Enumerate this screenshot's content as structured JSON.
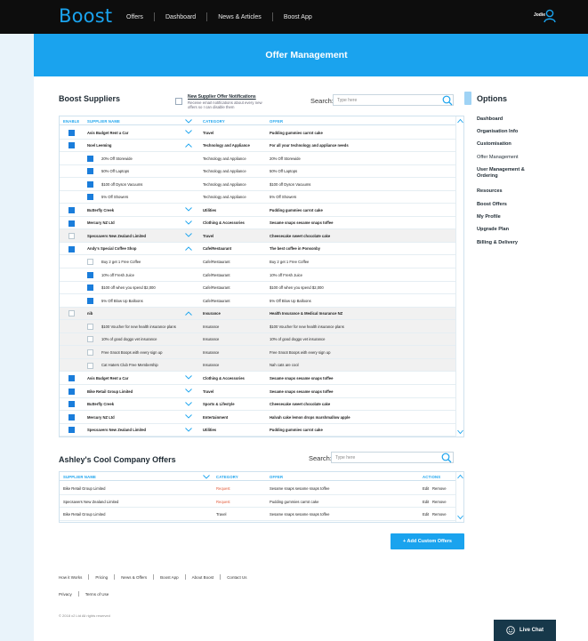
{
  "nav": {
    "brand": "Boost",
    "links": [
      "Offers",
      "Dashboard",
      "News & Articles",
      "Boost App"
    ],
    "user": "Jodie"
  },
  "banner": {
    "title": "Offer Management"
  },
  "suppliers": {
    "title": "Boost Suppliers",
    "notification_title": "New Supplier Offer Notifications",
    "notification_desc": "Receive email notifications about every new offers so I can disable them",
    "search_label": "Search:",
    "search_placeholder": "Type here",
    "columns": [
      "ENABLE",
      "SUPPLIER NAME",
      "CATEGORY",
      "OFFER"
    ],
    "rows": [
      {
        "level": 0,
        "checked": true,
        "name": "Avis Budget Rent a Car",
        "chev": "down",
        "category": "Travel",
        "offer": "Pudding gummies carrot cake",
        "alt": false
      },
      {
        "level": 0,
        "checked": true,
        "name": "Noel Leeming",
        "chev": "up",
        "category": "Technology and Appliance",
        "offer": "For all your technology and appliance needs",
        "alt": false
      },
      {
        "level": 1,
        "checked": true,
        "name": "20% Off Storewide",
        "chev": "",
        "category": "Technology and Appliance",
        "offer": "20% Off Storewide",
        "alt": false
      },
      {
        "level": 1,
        "checked": true,
        "name": "50% Off Laptops",
        "chev": "",
        "category": "Technology and Appliance",
        "offer": "50% Off Laptops",
        "alt": false
      },
      {
        "level": 1,
        "checked": true,
        "name": "$100 off Dyson Vacuums",
        "chev": "",
        "category": "Technology and Appliance",
        "offer": "$100 off Dyson Vacuums",
        "alt": false
      },
      {
        "level": 1,
        "checked": true,
        "name": "5% Off Showers",
        "chev": "",
        "category": "Technology and Appliance",
        "offer": "5% Off Showers",
        "alt": false
      },
      {
        "level": 0,
        "checked": true,
        "name": "Butterfly Creek",
        "chev": "down",
        "category": "Utilities",
        "offer": "Pudding gummies carrot cake",
        "alt": false
      },
      {
        "level": 0,
        "checked": true,
        "name": "Mercury NZ Ltd",
        "chev": "down",
        "category": "Clothing & Accessories",
        "offer": "Sesame snaps sesame snaps toffee",
        "alt": false
      },
      {
        "level": 0,
        "checked": false,
        "name": "Specsavers New Zealand Limited",
        "chev": "down",
        "category": "Travel",
        "offer": "Cheesecake sweet chocolate cake",
        "alt": true
      },
      {
        "level": 0,
        "checked": true,
        "name": "Andy's Special Coffee Shop",
        "chev": "up",
        "category": "Cafe/Restaurant",
        "offer": "The best coffee in Ponsonby",
        "alt": false
      },
      {
        "level": 1,
        "checked": false,
        "name": "Buy 2 get 1 Free Coffee",
        "chev": "",
        "category": "Cafe/Restaurant",
        "offer": "Buy 2 get 1 Free Coffee",
        "alt": false
      },
      {
        "level": 1,
        "checked": true,
        "name": "10% off Fresh Juice",
        "chev": "",
        "category": "Cafe/Restaurant",
        "offer": "10% off Fresh Juice",
        "alt": false
      },
      {
        "level": 1,
        "checked": true,
        "name": "$100 off when you spend $2,000",
        "chev": "",
        "category": "Cafe/Restaurant",
        "offer": "$100 off when you spend $2,000",
        "alt": false
      },
      {
        "level": 1,
        "checked": true,
        "name": "5% Off Blow Up Balloons",
        "chev": "",
        "category": "Cafe/Restaurant",
        "offer": "5% Off Blow Up Balloons",
        "alt": false
      },
      {
        "level": 0,
        "checked": false,
        "name": "nib",
        "chev": "up",
        "category": "Insurance",
        "offer": "Health Insurance & Medical Insurance NZ",
        "alt": true
      },
      {
        "level": 1,
        "checked": false,
        "name": "$100 Voucher for new health insurance plans",
        "chev": "",
        "category": "Insurance",
        "offer": "$100 Voucher for new health insurance plans",
        "alt": true
      },
      {
        "level": 1,
        "checked": false,
        "name": "10% of good doggo vet insurance",
        "chev": "",
        "category": "Insurance",
        "offer": "10% of good doggo vet insurance",
        "alt": true
      },
      {
        "level": 1,
        "checked": false,
        "name": "Free Snoot Boops with every sign up",
        "chev": "",
        "category": "Insurance",
        "offer": "Free Snoot Boops with every sign up",
        "alt": true
      },
      {
        "level": 1,
        "checked": false,
        "name": "Cat Haters Club Free Membership",
        "chev": "",
        "category": "Insurance",
        "offer": "Nah cats are cool",
        "alt": true
      },
      {
        "level": 0,
        "checked": true,
        "name": "Avis Budget Rent a Car",
        "chev": "down",
        "category": "Clothing & Accessories",
        "offer": "Sesame snaps sesame snaps toffee",
        "alt": false
      },
      {
        "level": 0,
        "checked": true,
        "name": "Bike Retail Group Limited",
        "chev": "down",
        "category": "Travel",
        "offer": "Sesame snaps sesame snaps toffee",
        "alt": false
      },
      {
        "level": 0,
        "checked": true,
        "name": "Butterfly Creek",
        "chev": "down",
        "category": "Sports & Lifestyle",
        "offer": "Cheesecake sweet chocolate cake",
        "alt": false
      },
      {
        "level": 0,
        "checked": true,
        "name": "Mercury NZ Ltd",
        "chev": "down",
        "category": "Entertainment",
        "offer": "Halvah cake lemon drops marshmallow apple",
        "alt": false
      },
      {
        "level": 0,
        "checked": true,
        "name": "Specsavers New Zealand Limited",
        "chev": "down",
        "category": "Utilities",
        "offer": "Pudding gummies carrot cake",
        "alt": false
      }
    ]
  },
  "options": {
    "title": "Options",
    "items": [
      {
        "label": "Dashboard",
        "bold": true
      },
      {
        "label": "Organisation Info",
        "bold": true
      },
      {
        "label": "Customisation",
        "bold": true
      },
      {
        "label": "Offer Management",
        "bold": false
      },
      {
        "label": "User Management & Ordering",
        "bold": true
      },
      {
        "label": "Resources",
        "bold": true
      },
      {
        "label": "Boost Offers",
        "bold": true
      },
      {
        "label": "My Profile",
        "bold": true
      },
      {
        "label": "Upgrade Plan",
        "bold": true
      },
      {
        "label": "Billing & Delivery",
        "bold": true
      }
    ]
  },
  "company": {
    "title": "Ashley's Cool Company Offers",
    "search_label": "Search:",
    "search_placeholder": "Type here",
    "columns": [
      "SUPPLIER NAME",
      "CATEGORY",
      "OFFER",
      "ACTIONS"
    ],
    "rows": [
      {
        "name": "Bike Retail Group Limited",
        "category": "Request",
        "category_red": true,
        "offer": "Sesame snaps sesame snaps toffee",
        "edit": "Edit",
        "remove": "Remove"
      },
      {
        "name": "Specsavers New Zealand Limited",
        "category": "Request",
        "category_red": true,
        "offer": "Pudding gummies carrot cake",
        "edit": "Edit",
        "remove": "Remove"
      },
      {
        "name": "Bike Retail Group Limited",
        "category": "Travel",
        "category_red": false,
        "offer": "Sesame snaps sesame snaps toffee",
        "edit": "Edit",
        "remove": "Remove"
      }
    ],
    "add_button": "+ Add Custom Offers"
  },
  "footer": {
    "links": [
      "How it Works",
      "Pricing",
      "News & Offers",
      "Boost App",
      "About Boost",
      "Contact Us"
    ],
    "links2": [
      "Privacy",
      "Terms of Use"
    ],
    "copyright": "© 2018 x2 Ltd All rights reserved"
  },
  "live_chat": {
    "label": "Live Chat"
  },
  "colors": {
    "accent": "#1aa3ee",
    "checkbox": "#1a7ddb",
    "dark": "#0d0d0d",
    "request": "#e25c3b",
    "chat": "#17384a"
  }
}
